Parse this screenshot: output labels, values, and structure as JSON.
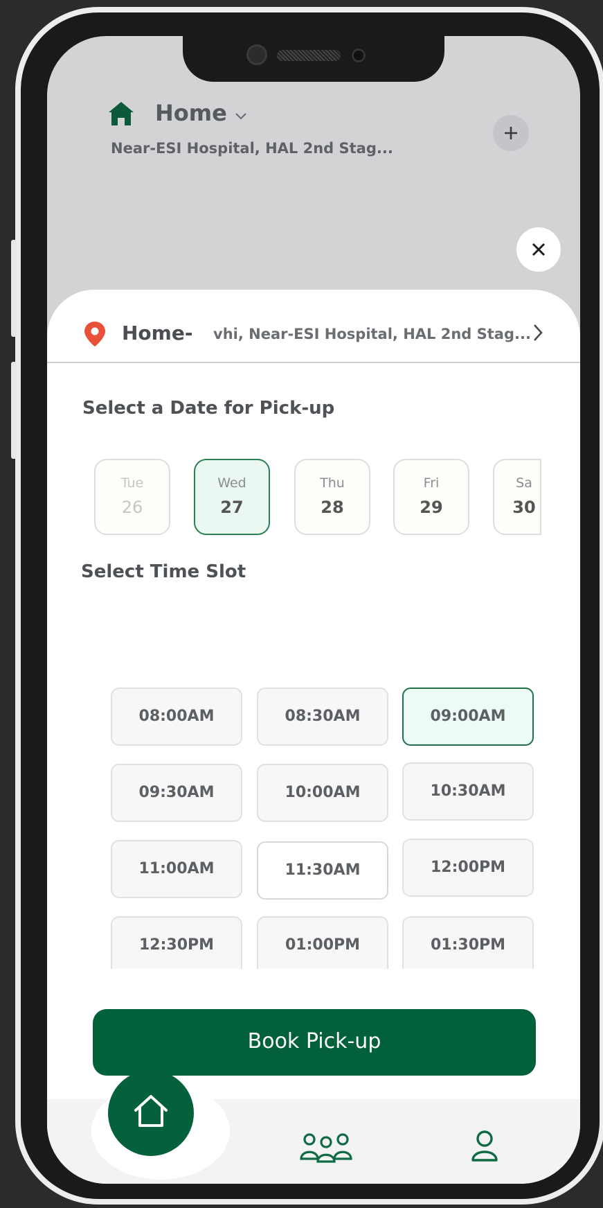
{
  "header": {
    "location_label": "Home",
    "address": "Near-ESI Hospital, HAL 2nd Stag..."
  },
  "sheet": {
    "address_title": "Home-",
    "address_text": "vhi, Near-ESI Hospital, HAL 2nd Stag...",
    "date_section_title": "Select a Date for Pick-up",
    "dates": [
      {
        "dow": "Tue",
        "day": "26",
        "state": "disabled"
      },
      {
        "dow": "Wed",
        "day": "27",
        "state": "selected"
      },
      {
        "dow": "Thu",
        "day": "28",
        "state": "available"
      },
      {
        "dow": "Fri",
        "day": "29",
        "state": "available"
      },
      {
        "dow": "Sa",
        "day": "30",
        "state": "available"
      }
    ],
    "time_section_title": "Select Time Slot",
    "slots": [
      {
        "label": "08:00AM",
        "state": "available"
      },
      {
        "label": "08:30AM",
        "state": "available"
      },
      {
        "label": "09:00AM",
        "state": "selected"
      },
      {
        "label": "09:30AM",
        "state": "available"
      },
      {
        "label": "10:00AM",
        "state": "available"
      },
      {
        "label": "10:30AM",
        "state": "available"
      },
      {
        "label": "11:00AM",
        "state": "available"
      },
      {
        "label": "11:30AM",
        "state": "available"
      },
      {
        "label": "12:00PM",
        "state": "available"
      },
      {
        "label": "12:30PM",
        "state": "available"
      },
      {
        "label": "01:00PM",
        "state": "available"
      },
      {
        "label": "01:30PM",
        "state": "available"
      }
    ],
    "book_button_label": "Book Pick-up"
  },
  "colors": {
    "brand_green": "#02603b",
    "selected_border": "#2a7f55",
    "selected_fill": "#eaf8f1",
    "pin_red": "#e8503a"
  },
  "icons": {
    "header_home": "home-filled-icon",
    "dropdown": "chevron-down-icon",
    "add": "plus-icon",
    "close": "close-icon",
    "pin": "location-pin-icon",
    "forward": "chevron-right-icon",
    "nav_home": "home-outline-icon",
    "nav_group": "group-icon",
    "nav_profile": "profile-icon"
  }
}
